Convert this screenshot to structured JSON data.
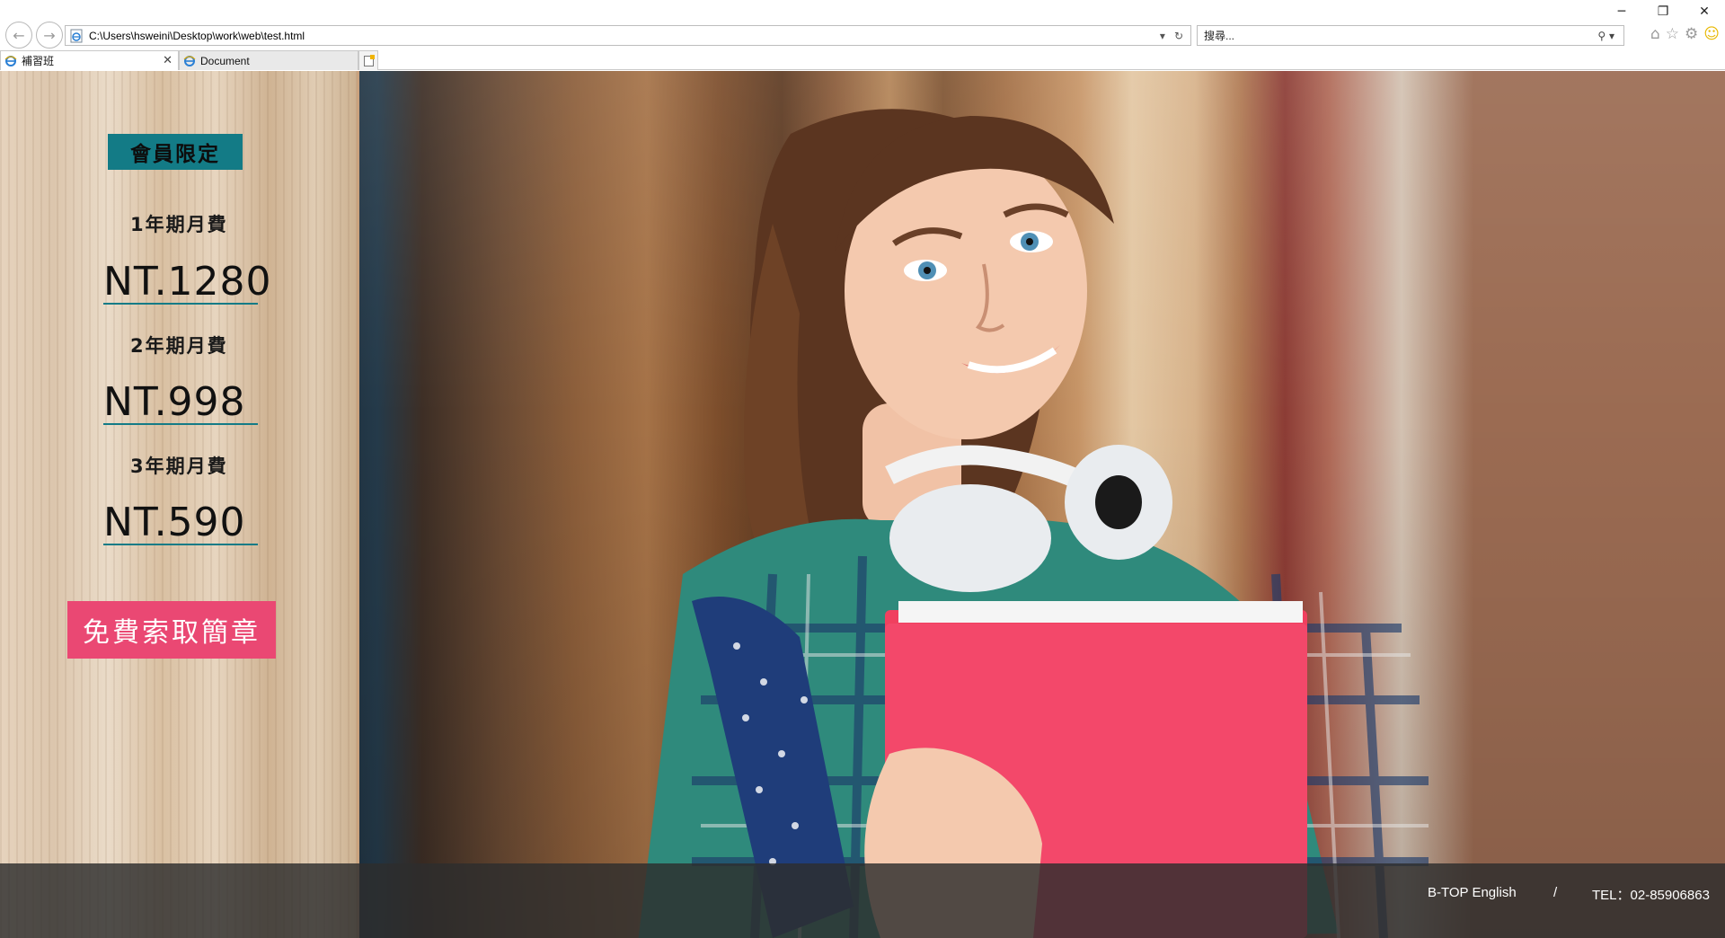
{
  "browser": {
    "window_controls": {
      "minimize": "─",
      "restore": "❐",
      "close": "✕"
    },
    "address": "C:\\Users\\hsweini\\Desktop\\work\\web\\test.html",
    "search_placeholder": "搜尋...",
    "tabs": [
      {
        "label": "補習班",
        "close": "✕"
      },
      {
        "label": "Document"
      }
    ]
  },
  "page": {
    "member_badge": "會員限定",
    "plans": [
      {
        "label": "1年期月費",
        "price": "NT.1280"
      },
      {
        "label": "2年期月費",
        "price": "NT.998"
      },
      {
        "label": "3年期月費",
        "price": "NT.590"
      }
    ],
    "brochure_button": "免費索取簡章",
    "footer": {
      "brand": "B-TOP English",
      "separator": "/",
      "tel": "TEL：02-85906863"
    }
  },
  "colors": {
    "accent_teal": "#137b86",
    "button_pink": "#ea4873",
    "folder_pink": "#f0405f"
  }
}
